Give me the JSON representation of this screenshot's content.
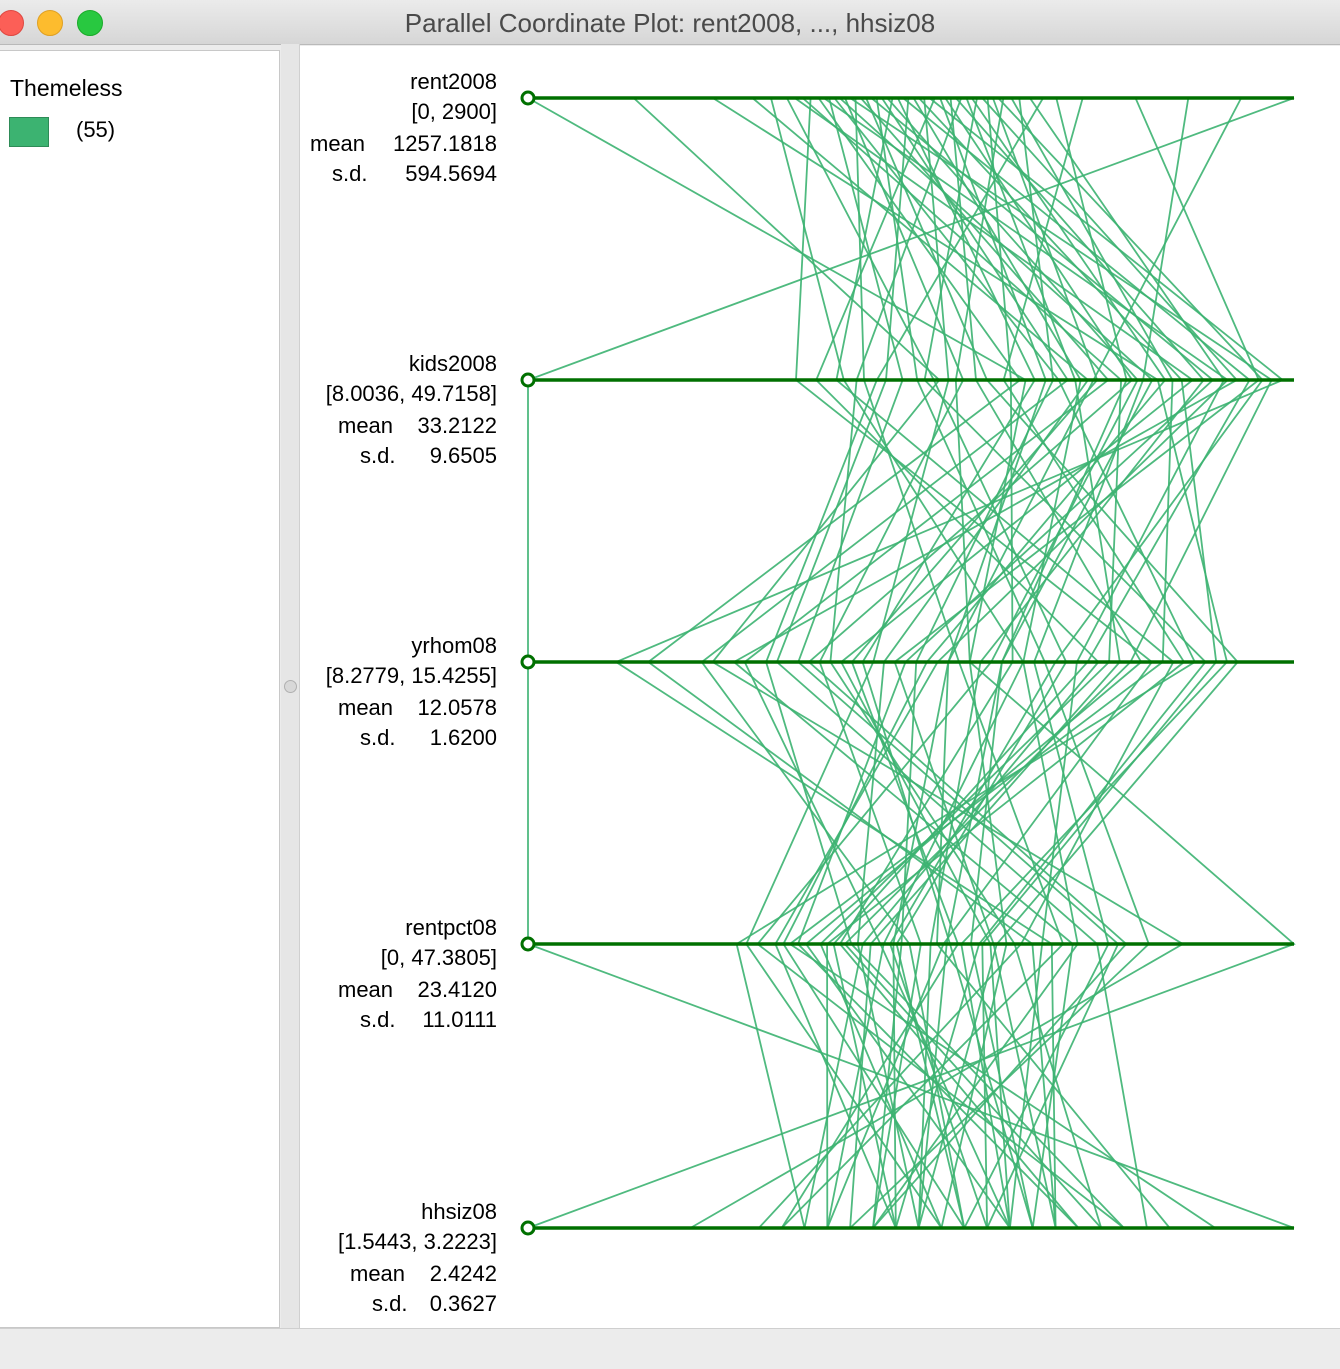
{
  "window": {
    "title": "Parallel Coordinate Plot: rent2008, ..., hhsiz08"
  },
  "legend": {
    "title": "Themeless",
    "count": "(55)",
    "color": "#3cb371"
  },
  "colors": {
    "line": "#3cb371",
    "axis": "#007000"
  },
  "axes": [
    {
      "name": "rent2008",
      "range": "[0, 2900]",
      "mean_label": "mean",
      "mean": "1257.1818",
      "sd_label": "s.d.",
      "sd": "594.5694"
    },
    {
      "name": "kids2008",
      "range": "[8.0036, 49.7158]",
      "mean_label": "mean",
      "mean": "33.2122",
      "sd_label": "s.d.",
      "sd": "9.6505"
    },
    {
      "name": "yrhom08",
      "range": "[8.2779, 15.4255]",
      "mean_label": "mean",
      "mean": "12.0578",
      "sd_label": "s.d.",
      "sd": "1.6200"
    },
    {
      "name": "rentpct08",
      "range": "[0, 47.3805]",
      "mean_label": "mean",
      "mean": "23.4120",
      "sd_label": "s.d.",
      "sd": "11.0111"
    },
    {
      "name": "hhsiz08",
      "range": "[1.5443, 3.2223]",
      "mean_label": "mean",
      "mean": "2.4242",
      "sd_label": "s.d.",
      "sd": "0.3627"
    }
  ],
  "chart_data": {
    "type": "parallel_coordinates",
    "variables": [
      "rent2008",
      "kids2008",
      "yrhom08",
      "rentpct08",
      "hhsiz08"
    ],
    "ranges": [
      [
        0,
        2900
      ],
      [
        8.0036,
        49.7158
      ],
      [
        8.2779,
        15.4255
      ],
      [
        0,
        47.3805
      ],
      [
        1.5443,
        3.2223
      ]
    ],
    "observations": [
      [
        0,
        35.1,
        12.4,
        47.38,
        1.544
      ],
      [
        2900,
        8.0036,
        8.2779,
        0,
        3.2223
      ],
      [
        850,
        38.5,
        11.6,
        20.4,
        2.4
      ],
      [
        920,
        25.2,
        12.9,
        34.0,
        2.3
      ],
      [
        980,
        30.1,
        13.3,
        22.8,
        2.5
      ],
      [
        1010,
        44.2,
        11.2,
        28.6,
        2.6
      ],
      [
        1040,
        40.3,
        13.7,
        18.1,
        2.45
      ],
      [
        1070,
        22.6,
        14.1,
        25.7,
        2.2
      ],
      [
        1100,
        34.8,
        9.4,
        31.2,
        2.7
      ],
      [
        1120,
        46.1,
        12.1,
        15.3,
        2.35
      ],
      [
        1140,
        28.4,
        10.8,
        36.5,
        2.55
      ],
      [
        1160,
        36.9,
        14.5,
        12.9,
        2.15
      ],
      [
        1180,
        42.0,
        12.7,
        27.4,
        2.65
      ],
      [
        1200,
        31.7,
        11.0,
        24.3,
        2.3
      ],
      [
        1220,
        48.5,
        13.9,
        19.6,
        2.8
      ],
      [
        1240,
        26.3,
        12.3,
        33.1,
        2.1
      ],
      [
        1260,
        39.6,
        10.3,
        21.8,
        2.6
      ],
      [
        1280,
        33.0,
        14.9,
        29.0,
        2.4
      ],
      [
        1300,
        45.3,
        11.8,
        16.7,
        2.75
      ],
      [
        1320,
        29.2,
        13.1,
        38.4,
        2.25
      ],
      [
        1340,
        37.4,
        9.9,
        23.6,
        2.5
      ],
      [
        1360,
        41.2,
        12.6,
        14.2,
        2.85
      ],
      [
        1380,
        24.8,
        14.3,
        30.5,
        2.05
      ],
      [
        1400,
        35.6,
        11.4,
        26.1,
        2.65
      ],
      [
        1420,
        47.3,
        13.5,
        18.9,
        2.35
      ],
      [
        1440,
        27.5,
        10.6,
        35.2,
        2.9
      ],
      [
        1460,
        38.1,
        12.9,
        22.0,
        2.2
      ],
      [
        1480,
        43.6,
        14.7,
        28.1,
        2.55
      ],
      [
        1500,
        30.9,
        11.5,
        13.5,
        2.45
      ],
      [
        1520,
        49.1,
        9.1,
        32.4,
        2.7
      ],
      [
        1540,
        23.7,
        13.6,
        20.7,
        2.15
      ],
      [
        1560,
        36.2,
        12.2,
        25.3,
        2.95
      ],
      [
        1580,
        40.9,
        10.9,
        37.0,
        2.3
      ],
      [
        1600,
        32.4,
        14.0,
        17.2,
        2.6
      ],
      [
        1620,
        44.8,
        12.5,
        24.9,
        2.4
      ],
      [
        1640,
        25.9,
        11.1,
        30.1,
        2.8
      ],
      [
        1660,
        37.8,
        13.8,
        21.2,
        2.25
      ],
      [
        1680,
        42.7,
        12.0,
        15.8,
        2.5
      ],
      [
        1700,
        29.6,
        14.6,
        27.9,
        2.35
      ],
      [
        1720,
        46.6,
        10.2,
        33.7,
        2.65
      ],
      [
        1740,
        34.3,
        12.8,
        19.3,
        2.75
      ],
      [
        1760,
        39.0,
        11.3,
        26.6,
        2.1
      ],
      [
        1780,
        48.0,
        13.2,
        22.4,
        2.55
      ],
      [
        1800,
        31.3,
        12.4,
        29.6,
        2.45
      ],
      [
        1830,
        43.1,
        14.2,
        16.2,
        3.05
      ],
      [
        1860,
        36.6,
        11.9,
        23.1,
        2.3
      ],
      [
        1900,
        45.9,
        13.4,
        31.8,
        2.6
      ],
      [
        1950,
        27.0,
        10.5,
        20.0,
        2.85
      ],
      [
        2000,
        40.6,
        12.7,
        25.9,
        2.4
      ],
      [
        2100,
        33.9,
        14.4,
        18.5,
        2.2
      ],
      [
        2300,
        47.8,
        11.7,
        28.8,
        2.7
      ],
      [
        2500,
        41.5,
        13.0,
        35.9,
        2.5
      ],
      [
        2700,
        38.8,
        12.2,
        22.6,
        2.35
      ],
      [
        700,
        42.3,
        14.8,
        26.8,
        2.6
      ],
      [
        400,
        30.4,
        10.0,
        40.5,
        1.9
      ]
    ]
  }
}
